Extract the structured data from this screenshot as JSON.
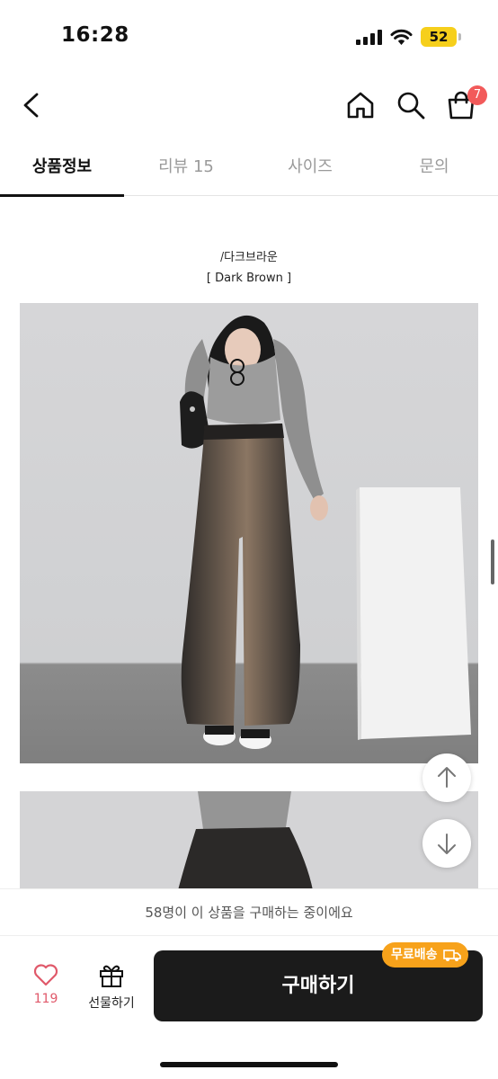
{
  "status": {
    "time": "16:28",
    "battery": "52"
  },
  "header": {
    "cart_count": "7"
  },
  "tabs": [
    {
      "label": "상품정보",
      "active": true
    },
    {
      "label": "리뷰 15",
      "active": false
    },
    {
      "label": "사이즈",
      "active": false
    },
    {
      "label": "문의",
      "active": false
    }
  ],
  "product": {
    "color_name": "/다크브라운",
    "color_sub": "[ Dark Brown ]"
  },
  "notice": "58명이 이 상품을 구매하는 중이에요",
  "bottom": {
    "like_count": "119",
    "gift_label": "선물하기",
    "buy_label": "구매하기",
    "shipping_badge": "무료배송"
  },
  "colors": {
    "badge_red": "#f25a5a",
    "shipping_orange": "#f7a21b",
    "buy_bg": "#1b1b1b",
    "like_pink": "#e0596a"
  }
}
